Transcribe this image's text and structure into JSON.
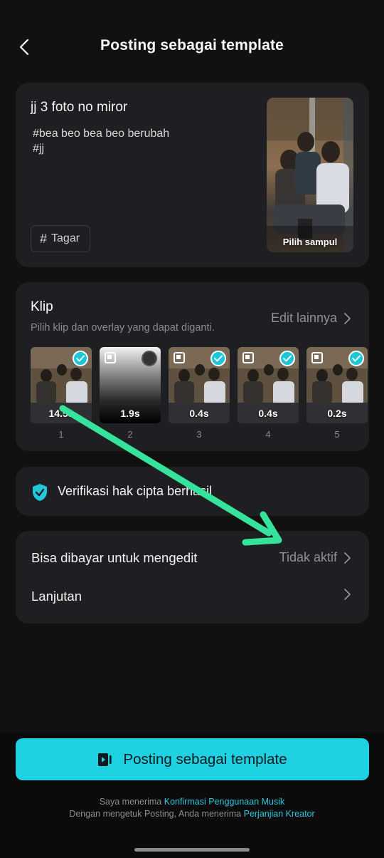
{
  "header": {
    "title": "Posting sebagai template",
    "back_icon": "chevron-left-icon"
  },
  "template_info": {
    "title": "jj 3 foto no miror",
    "description": "#bea beo bea beo berubah\n#jj",
    "tag_button_label": "Tagar",
    "tag_icon": "#",
    "cover_label": "Pilih sampul"
  },
  "clips": {
    "title": "Klip",
    "subtitle": "Pilih klip dan overlay yang dapat diganti.",
    "edit_more_label": "Edit lainnya",
    "items": [
      {
        "number": "1",
        "duration": "14.5s",
        "selected": true,
        "kind": "photo"
      },
      {
        "number": "2",
        "duration": "1.9s",
        "selected": false,
        "kind": "overlay"
      },
      {
        "number": "3",
        "duration": "0.4s",
        "selected": true,
        "kind": "photo"
      },
      {
        "number": "4",
        "duration": "0.4s",
        "selected": true,
        "kind": "photo"
      },
      {
        "number": "5",
        "duration": "0.2s",
        "selected": true,
        "kind": "photo"
      }
    ]
  },
  "verification": {
    "text": "Verifikasi hak cipta berhasil",
    "icon": "shield-check-icon"
  },
  "settings": {
    "paid_edit_label": "Bisa dibayar untuk mengedit",
    "paid_edit_value": "Tidak aktif",
    "advanced_label": "Lanjutan"
  },
  "post_button": {
    "label": "Posting sebagai template",
    "icon": "template-icon"
  },
  "terms": {
    "line1_prefix": "Saya menerima ",
    "line1_link": "Konfirmasi Penggunaan Musik",
    "line2_prefix": "Dengan mengetuk Posting, Anda menerima ",
    "line2_link": "Perjanjian Kreator"
  },
  "colors": {
    "accent": "#1ed1e3",
    "card_bg": "#1e1f22",
    "page_bg": "#111111",
    "annotation_arrow": "#35e39a"
  }
}
